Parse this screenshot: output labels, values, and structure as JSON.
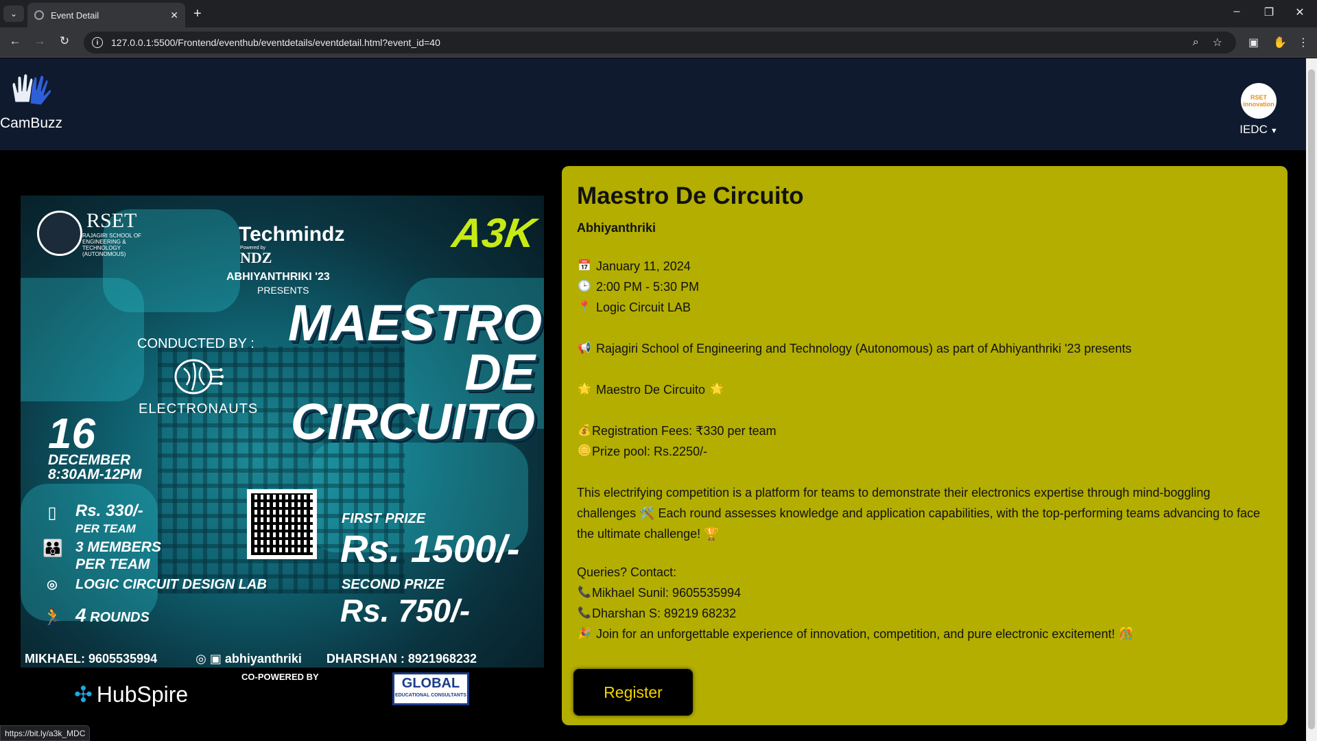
{
  "browser": {
    "tab_title": "Event Detail",
    "url": "127.0.0.1:5500/Frontend/eventhub/eventdetails/eventdetail.html?event_id=40",
    "status_url": "https://bit.ly/a3k_MDC"
  },
  "header": {
    "brand": "CamBuzz",
    "org_name": "IEDC",
    "org_avatar_text": "RSET innovation"
  },
  "poster": {
    "rset": "RSET",
    "rset_sub": "RAJAGIRI SCHOOL OF ENGINEERING & TECHNOLOGY (AUTONOMOUS)",
    "techmindz": "Techmindz",
    "powered_by": "Powered by",
    "ndz": "NDZ",
    "a3k": "A3K",
    "abhiyanthriki": "ABHIYANTHRIKI '23",
    "presents": "PRESENTS",
    "maestro": [
      "MAESTRO",
      "DE",
      "CIRCUITO"
    ],
    "conducted_by": "CONDUCTED BY :",
    "electronauts": "ELECTRONAUTS",
    "date_num": "16",
    "date_month": "DECEMBER",
    "date_time": "8:30AM-12PM",
    "fee": "Rs. 330/-",
    "fee_sub": "PER TEAM",
    "members": "3 MEMBERS",
    "members_sub": "PER TEAM",
    "venue": "LOGIC CIRCUIT DESIGN LAB",
    "rounds_num": "4",
    "rounds": "ROUNDS",
    "first_prize_label": "FIRST PRIZE",
    "first_prize": "Rs. 1500/-",
    "second_prize_label": "SECOND PRIZE",
    "second_prize": "Rs. 750/-",
    "contact_1": "MIKHAEL: 9605535994",
    "social": "abhiyanthriki",
    "contact_2": "DHARSHAN : 8921968232",
    "hubspire": "HubSpire",
    "copowered": "CO-POWERED BY",
    "global": "GLOBAL",
    "global_sub": "EDUCATIONAL CONSULTANTS"
  },
  "event": {
    "title": "Maestro De Circuito",
    "organizer": "Abhiyanthriki",
    "date": "January 11, 2024",
    "time": "2:00 PM - 5:30 PM",
    "venue": "Logic Circuit LAB",
    "intro": "Rajagiri School of Engineering and Technology (Autonomous) as part of Abhiyanthriki '23 presents",
    "name_line": "Maestro De Circuito",
    "fees": "Registration Fees: ₹330 per team",
    "prize": "Prize pool: Rs.2250/-",
    "description": "This electrifying competition is a platform for teams to demonstrate their electronics expertise through mind-boggling challenges 🛠️ Each round assesses knowledge and application capabilities, with the top-performing teams advancing to face the ultimate challenge! 🏆",
    "queries": "Queries? Contact:",
    "contact_1": "Mikhael Sunil: 9605535994",
    "contact_2": "Dharshan S: 89219 68232",
    "closing": "Join for an unforgettable experience of innovation, competition, and pure electronic excitement! 🎊",
    "register_label": "Register"
  },
  "icons": {
    "calendar": "calendar-icon",
    "clock": "clock-icon",
    "pin": "location-pin-icon",
    "megaphone": "megaphone-icon",
    "sun": "sparkle-icon",
    "money": "money-bag-icon",
    "coin": "coin-icon",
    "phone": "phone-icon",
    "party": "party-popper-icon"
  },
  "colors": {
    "header_bg": "#0f1a2e",
    "panel_bg": "#b3ae00",
    "button_bg": "#000000",
    "button_text": "#f4d400"
  }
}
